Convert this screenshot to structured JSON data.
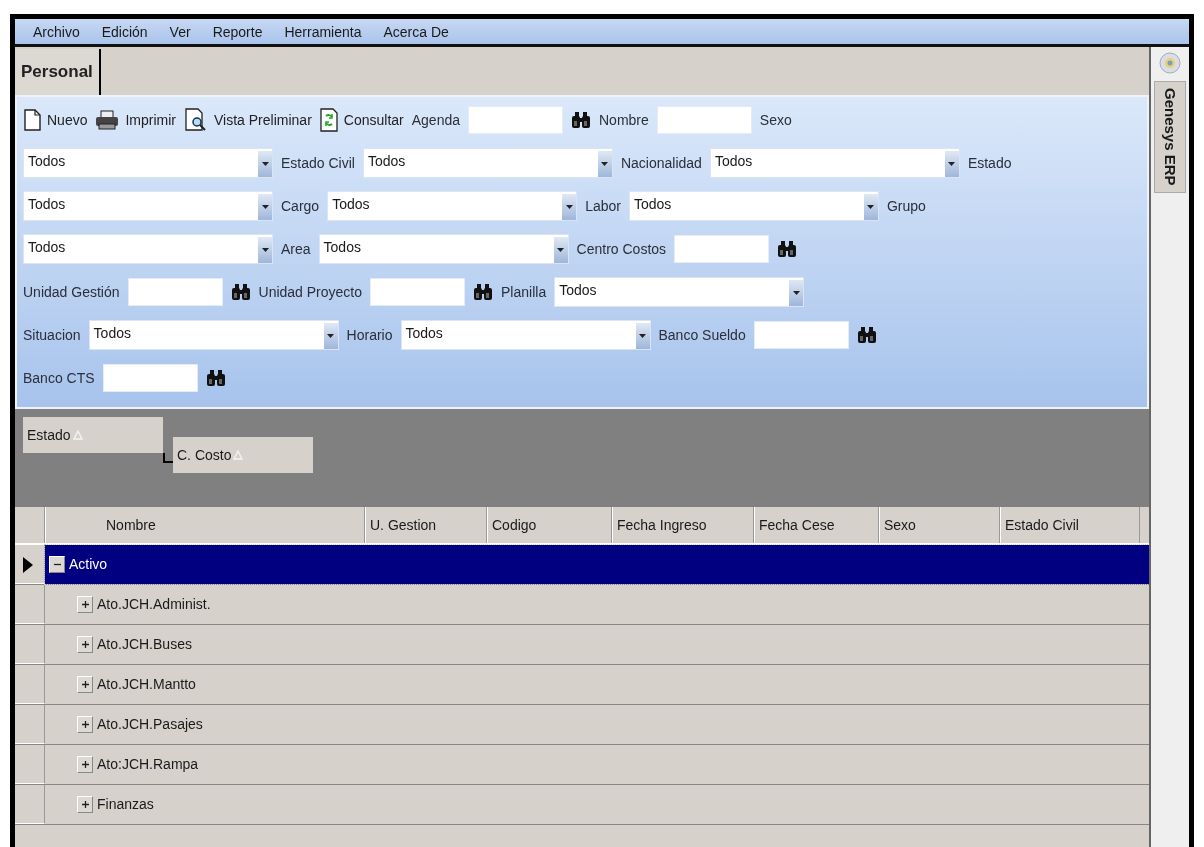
{
  "menu": [
    "Archivo",
    "Edición",
    "Ver",
    "Reporte",
    "Herramienta",
    "Acerca De"
  ],
  "tabs": [
    {
      "label": "Personal",
      "selected": true
    }
  ],
  "toolbar": [
    {
      "label": "Nuevo"
    },
    {
      "label": "Imprimir"
    },
    {
      "label": "Vista Preliminar"
    },
    {
      "label": "Consultar"
    }
  ],
  "filter_rows": [
    [
      {
        "kind": "label",
        "text": "Agenda"
      },
      {
        "kind": "text"
      },
      {
        "kind": "search"
      },
      {
        "kind": "label",
        "text": "Nombre"
      },
      {
        "kind": "text"
      },
      {
        "kind": "label",
        "text": "Sexo"
      }
    ],
    [
      {
        "kind": "combo",
        "value": "Todos"
      },
      {
        "kind": "label",
        "text": "Estado Civil"
      },
      {
        "kind": "combo",
        "value": "Todos"
      },
      {
        "kind": "label",
        "text": "Nacionalidad"
      },
      {
        "kind": "combo",
        "value": "Todos"
      },
      {
        "kind": "label",
        "text": "Estado"
      }
    ],
    [
      {
        "kind": "combo",
        "value": "Todos"
      },
      {
        "kind": "label",
        "text": "Cargo"
      },
      {
        "kind": "combo",
        "value": "Todos"
      },
      {
        "kind": "label",
        "text": "Labor"
      },
      {
        "kind": "combo",
        "value": "Todos"
      },
      {
        "kind": "label",
        "text": "Grupo"
      }
    ],
    [
      {
        "kind": "combo",
        "value": "Todos"
      },
      {
        "kind": "label",
        "text": "Area"
      },
      {
        "kind": "combo",
        "value": "Todos"
      },
      {
        "kind": "label",
        "text": "Centro Costos"
      },
      {
        "kind": "text"
      },
      {
        "kind": "search"
      }
    ],
    [
      {
        "kind": "label",
        "text": "Unidad Gestión"
      },
      {
        "kind": "text"
      },
      {
        "kind": "search"
      },
      {
        "kind": "label",
        "text": "Unidad Proyecto"
      },
      {
        "kind": "text"
      },
      {
        "kind": "search"
      },
      {
        "kind": "label",
        "text": "Planilla"
      },
      {
        "kind": "combo",
        "value": "Todos"
      }
    ],
    [
      {
        "kind": "label",
        "text": "Situacion"
      },
      {
        "kind": "combo",
        "value": "Todos"
      },
      {
        "kind": "label",
        "text": "Horario"
      },
      {
        "kind": "combo",
        "value": "Todos"
      },
      {
        "kind": "label",
        "text": "Banco Sueldo"
      },
      {
        "kind": "text"
      },
      {
        "kind": "search"
      }
    ],
    [
      {
        "kind": "label",
        "text": "Banco CTS"
      },
      {
        "kind": "text"
      },
      {
        "kind": "search"
      }
    ]
  ],
  "group_by": [
    {
      "label": "Estado"
    },
    {
      "label": "C. Costo"
    }
  ],
  "table": {
    "columns": [
      "Nombre",
      "U. Gestion",
      "Codigo",
      "Fecha Ingreso",
      "Fecha Cese",
      "Sexo",
      "Estado Civil"
    ],
    "rows": [
      {
        "label": "Activo",
        "selected": true,
        "expanded": true,
        "children": [
          {
            "label": "Ato.JCH.Administ.",
            "selected": false,
            "expanded": false
          },
          {
            "label": "Ato.JCH.Buses",
            "selected": false,
            "expanded": false
          },
          {
            "label": "Ato.JCH.Mantto",
            "selected": false,
            "expanded": false
          },
          {
            "label": "Ato.JCH.Pasajes",
            "selected": false,
            "expanded": false
          },
          {
            "label": "Ato:JCH.Rampa",
            "selected": false,
            "expanded": false
          },
          {
            "label": "Finanzas",
            "selected": false,
            "expanded": false
          }
        ]
      }
    ]
  },
  "sidebar": {
    "tab": "Genesys ERP"
  }
}
